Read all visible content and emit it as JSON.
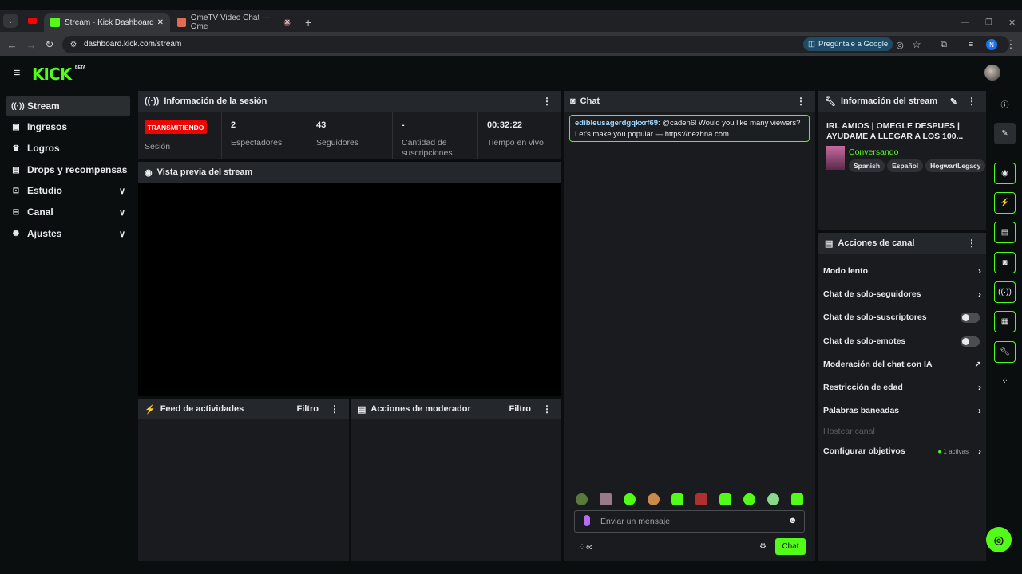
{
  "browser": {
    "tabs": [
      {
        "label": "Stream - Kick Dashboard"
      },
      {
        "label": "OmeTV Video Chat — Ome"
      }
    ],
    "url": "dashboard.kick.com/stream",
    "ask_google": "Pregúntale a Google",
    "profile_initial": "N"
  },
  "brand": {
    "logo": "KICK",
    "beta": "BETA",
    "accent": "#53fc18"
  },
  "sidebar": {
    "items": [
      {
        "label": "Stream",
        "icon": "broadcast-icon"
      },
      {
        "label": "Ingresos",
        "icon": "money-icon"
      },
      {
        "label": "Logros",
        "icon": "trophy-icon"
      },
      {
        "label": "Drops y recompensas",
        "icon": "gift-icon"
      },
      {
        "label": "Estudio",
        "icon": "studio-icon"
      },
      {
        "label": "Canal",
        "icon": "channel-icon"
      },
      {
        "label": "Ajustes",
        "icon": "gear-icon"
      }
    ]
  },
  "session": {
    "title": "Información de la sesión",
    "live_badge": "TRANSMITIENDO",
    "session_label": "Sesión",
    "stats": [
      {
        "value": "2",
        "label": "Espectadores"
      },
      {
        "value": "43",
        "label": "Seguidores"
      },
      {
        "value": "-",
        "label": "Cantidad de suscripciones"
      },
      {
        "value": "00:32:22",
        "label": "Tiempo en vivo"
      }
    ]
  },
  "preview": {
    "title": "Vista previa del stream"
  },
  "feed": {
    "title": "Feed de actividades",
    "filter": "Filtro"
  },
  "mod": {
    "title": "Acciones de moderador",
    "filter": "Filtro"
  },
  "chat": {
    "title": "Chat",
    "message": {
      "user": "edibleusagerdgqkxrf69",
      "text": ": @caden6l Would you like many viewers? Let's make you popular — https://nezhna.com"
    },
    "placeholder": "Enviar un mensaje",
    "send": "Chat"
  },
  "stream_info": {
    "title": "Información del stream",
    "stream_title": "IRL AMIOS | OMEGLE DESPUES | AYUDAME A LLEGAR A LOS 100...",
    "category": "Conversando",
    "tags": [
      "Spanish",
      "Español",
      "HogwartLegacy"
    ]
  },
  "channel_actions": {
    "title": "Acciones de canal",
    "items": [
      {
        "label": "Modo lento",
        "control": "chevron"
      },
      {
        "label": "Chat de solo-seguidores",
        "control": "chevron"
      },
      {
        "label": "Chat de solo-suscriptores",
        "control": "toggle"
      },
      {
        "label": "Chat de solo-emotes",
        "control": "toggle"
      },
      {
        "label": "Moderación del chat con IA",
        "control": "external"
      },
      {
        "label": "Restricción de edad",
        "control": "chevron"
      },
      {
        "label": "Palabras baneadas",
        "control": "chevron"
      },
      {
        "label": "Hostear canal",
        "control": "none"
      },
      {
        "label": "Configurar objetivos",
        "control": "chevron",
        "badge": "1 activas"
      }
    ]
  }
}
